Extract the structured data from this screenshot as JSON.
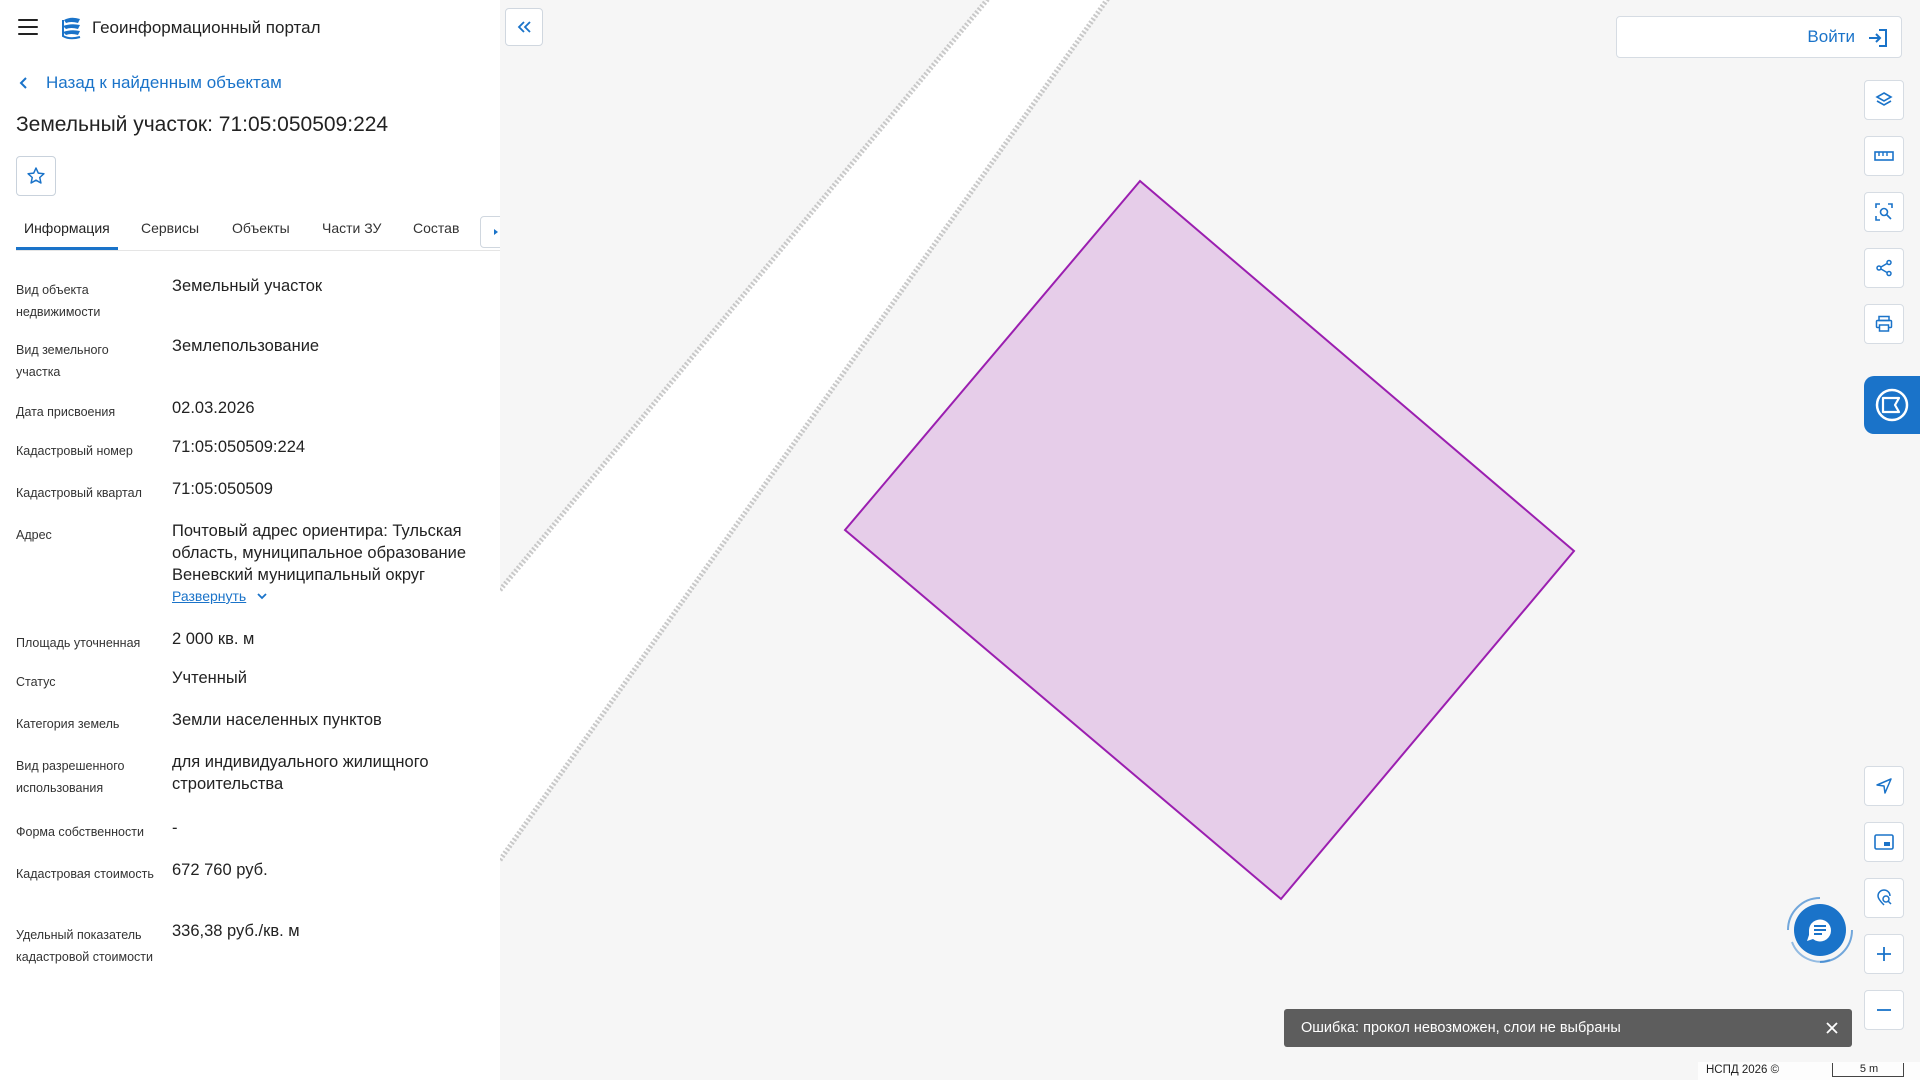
{
  "app": {
    "title": "Геоинформационный портал"
  },
  "nav": {
    "back_label": "Назад к найденным объектам"
  },
  "object": {
    "title": "Земельный участок: 71:05:050509:224"
  },
  "tabs": [
    {
      "label": "Информация",
      "active": true
    },
    {
      "label": "Сервисы"
    },
    {
      "label": "Объекты"
    },
    {
      "label": "Части ЗУ"
    },
    {
      "label": "Состав"
    }
  ],
  "info": {
    "rows": [
      {
        "label": "Вид объекта недвижимости",
        "value": "Земельный участок"
      },
      {
        "label": "Вид земельного участка",
        "value": "Землепользование"
      },
      {
        "label": "Дата присвоения",
        "value": "02.03.2026"
      },
      {
        "label": "Кадастровый номер",
        "value": "71:05:050509:224"
      },
      {
        "label": "Кадастровый квартал",
        "value": "71:05:050509"
      },
      {
        "label": "Адрес",
        "value": "Почтовый адрес ориентира: Тульская область, муниципальное образование Веневский муниципальный округ"
      },
      {
        "label": "Площадь уточненная",
        "value": "2 000 кв. м"
      },
      {
        "label": "Статус",
        "value": "Учтенный"
      },
      {
        "label": "Категория земель",
        "value": "Земли населенных пунктов"
      },
      {
        "label": "Вид разрешенного использования",
        "value": "для индивидуального жилищного строительства"
      },
      {
        "label": "Форма собственности",
        "value": "-"
      },
      {
        "label": "Кадастровая стоимость",
        "value": "672 760 руб."
      },
      {
        "label": "Удельный показатель кадастровой стоимости",
        "value": "336,38 руб./кв. м"
      }
    ],
    "expand_label": "Развернуть"
  },
  "header": {
    "login_label": "Войти"
  },
  "toolbar": {
    "tools": [
      "layers-icon",
      "ruler-icon",
      "area-search-icon",
      "share-icon",
      "print-icon"
    ],
    "bottom_tools": [
      "navigate-icon",
      "minimap-icon",
      "location-search-icon",
      "zoom-in-icon",
      "zoom-out-icon"
    ]
  },
  "toast": {
    "text": "Ошибка: прокол невозможен, слои не выбраны"
  },
  "footer": {
    "attribution": "НСПД 2026 ©",
    "scale_label": "5 m"
  },
  "colors": {
    "accent": "#1a73c9",
    "parcel_fill": "#e6cde9",
    "parcel_stroke": "#9b1fb0"
  }
}
